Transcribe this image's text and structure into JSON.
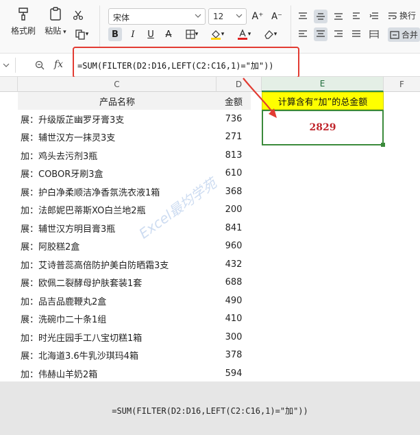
{
  "ribbon": {
    "format_painter": "格式刷",
    "paste": "粘贴",
    "font_name": "宋体",
    "font_size": "12",
    "wrap_text": "换行",
    "merge": "合并"
  },
  "formula_bar": {
    "fx": "fx",
    "formula": "=SUM(FILTER(D2:D16,LEFT(C2:C16,1)=\"加\"))"
  },
  "columns": {
    "c": "C",
    "d": "D",
    "e": "E",
    "f": "F"
  },
  "header": {
    "product": "产品名称",
    "amount": "金额",
    "task": "计算含有“加”的总金额"
  },
  "rows": [
    {
      "name": "展：升级版芷幽罗牙膏3支",
      "amount": "736"
    },
    {
      "name": "展：辅世汉方一抹灵3支",
      "amount": "271"
    },
    {
      "name": "加：鸡头去污剂3瓶",
      "amount": "813"
    },
    {
      "name": "展：COBOR牙刷3盒",
      "amount": "610"
    },
    {
      "name": "展：护白净柔顺洁净香氛洗衣液1箱",
      "amount": "368"
    },
    {
      "name": "加：法郎妮巴蒂斯XO白兰地2瓶",
      "amount": "200"
    },
    {
      "name": "展：辅世汉方明目膏3瓶",
      "amount": "841"
    },
    {
      "name": "展：阿胶糕2盒",
      "amount": "960"
    },
    {
      "name": "加：艾诗普蕊高倍防护美白防晒霜3支",
      "amount": "432"
    },
    {
      "name": "展：欧佩二裂酵母护肤套装1套",
      "amount": "688"
    },
    {
      "name": "加：品吉品鹿鞭丸2盒",
      "amount": "490"
    },
    {
      "name": "展：洗碗巾二十条1组",
      "amount": "410"
    },
    {
      "name": "加：时光庄园手工八宝切糕1箱",
      "amount": "300"
    },
    {
      "name": "展：北海道3.6牛乳沙琪玛4箱",
      "amount": "378"
    },
    {
      "name": "加：伟赫山羊奶2箱",
      "amount": "594"
    }
  ],
  "result": "2829",
  "watermark": "Excel最均学苑",
  "caption": "=SUM(FILTER(D2:D16,LEFT(C2:C16,1)=\"加\"))",
  "colors": {
    "highlight_yellow": "#ffff00",
    "result_red": "#c0262c",
    "frame_red": "#e23b32",
    "select_green": "#3a8a3a"
  }
}
